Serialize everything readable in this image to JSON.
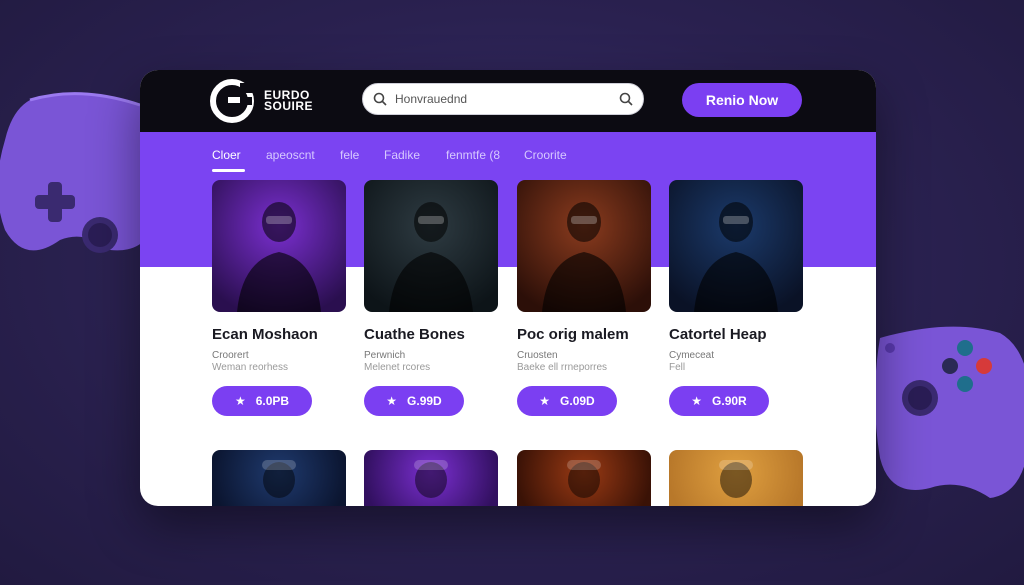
{
  "header": {
    "brand_line1": "EURDO",
    "brand_line2": "SOUIRE",
    "search_placeholder": "Honvrauednd",
    "cta_label": "Renio Now"
  },
  "tabs": [
    {
      "label": "Cloer",
      "active": true
    },
    {
      "label": "apeoscnt",
      "active": false
    },
    {
      "label": "fele",
      "active": false
    },
    {
      "label": "Fadike",
      "active": false
    },
    {
      "label": "fenmtfe (8",
      "active": false
    },
    {
      "label": "Croorite",
      "active": false
    }
  ],
  "cards": [
    {
      "title": "Ecan Moshaon",
      "sub1": "Croorert",
      "sub2": "Weman reorhess",
      "price": "6.0PB",
      "palette": [
        "#7a2fd0",
        "#2a0f4f"
      ]
    },
    {
      "title": "Cuathe Bones",
      "sub1": "Perwnich",
      "sub2": "Melenet rcores",
      "price": "G.99D",
      "palette": [
        "#2e3b42",
        "#0d1418"
      ]
    },
    {
      "title": "Poc orig malem",
      "sub1": "Cruosten",
      "sub2": "Baeke ell rrneporres",
      "price": "G.09D",
      "palette": [
        "#8a3b1e",
        "#2c0f08"
      ]
    },
    {
      "title": "Catortel Heap",
      "sub1": "Cymeceat",
      "sub2": "Fell",
      "price": "G.90R",
      "palette": [
        "#1b3a6b",
        "#0a1226"
      ]
    }
  ],
  "bottom_cards": [
    {
      "palette": [
        "#1f3a6e",
        "#0b1530"
      ]
    },
    {
      "palette": [
        "#7a2fd0",
        "#321060"
      ]
    },
    {
      "palette": [
        "#9a3a14",
        "#3a1206"
      ]
    },
    {
      "palette": [
        "#e0a040",
        "#b8782a"
      ]
    }
  ],
  "colors": {
    "accent": "#7b3ff2",
    "band": "#7b44f2",
    "topbar": "#0c0b12"
  }
}
